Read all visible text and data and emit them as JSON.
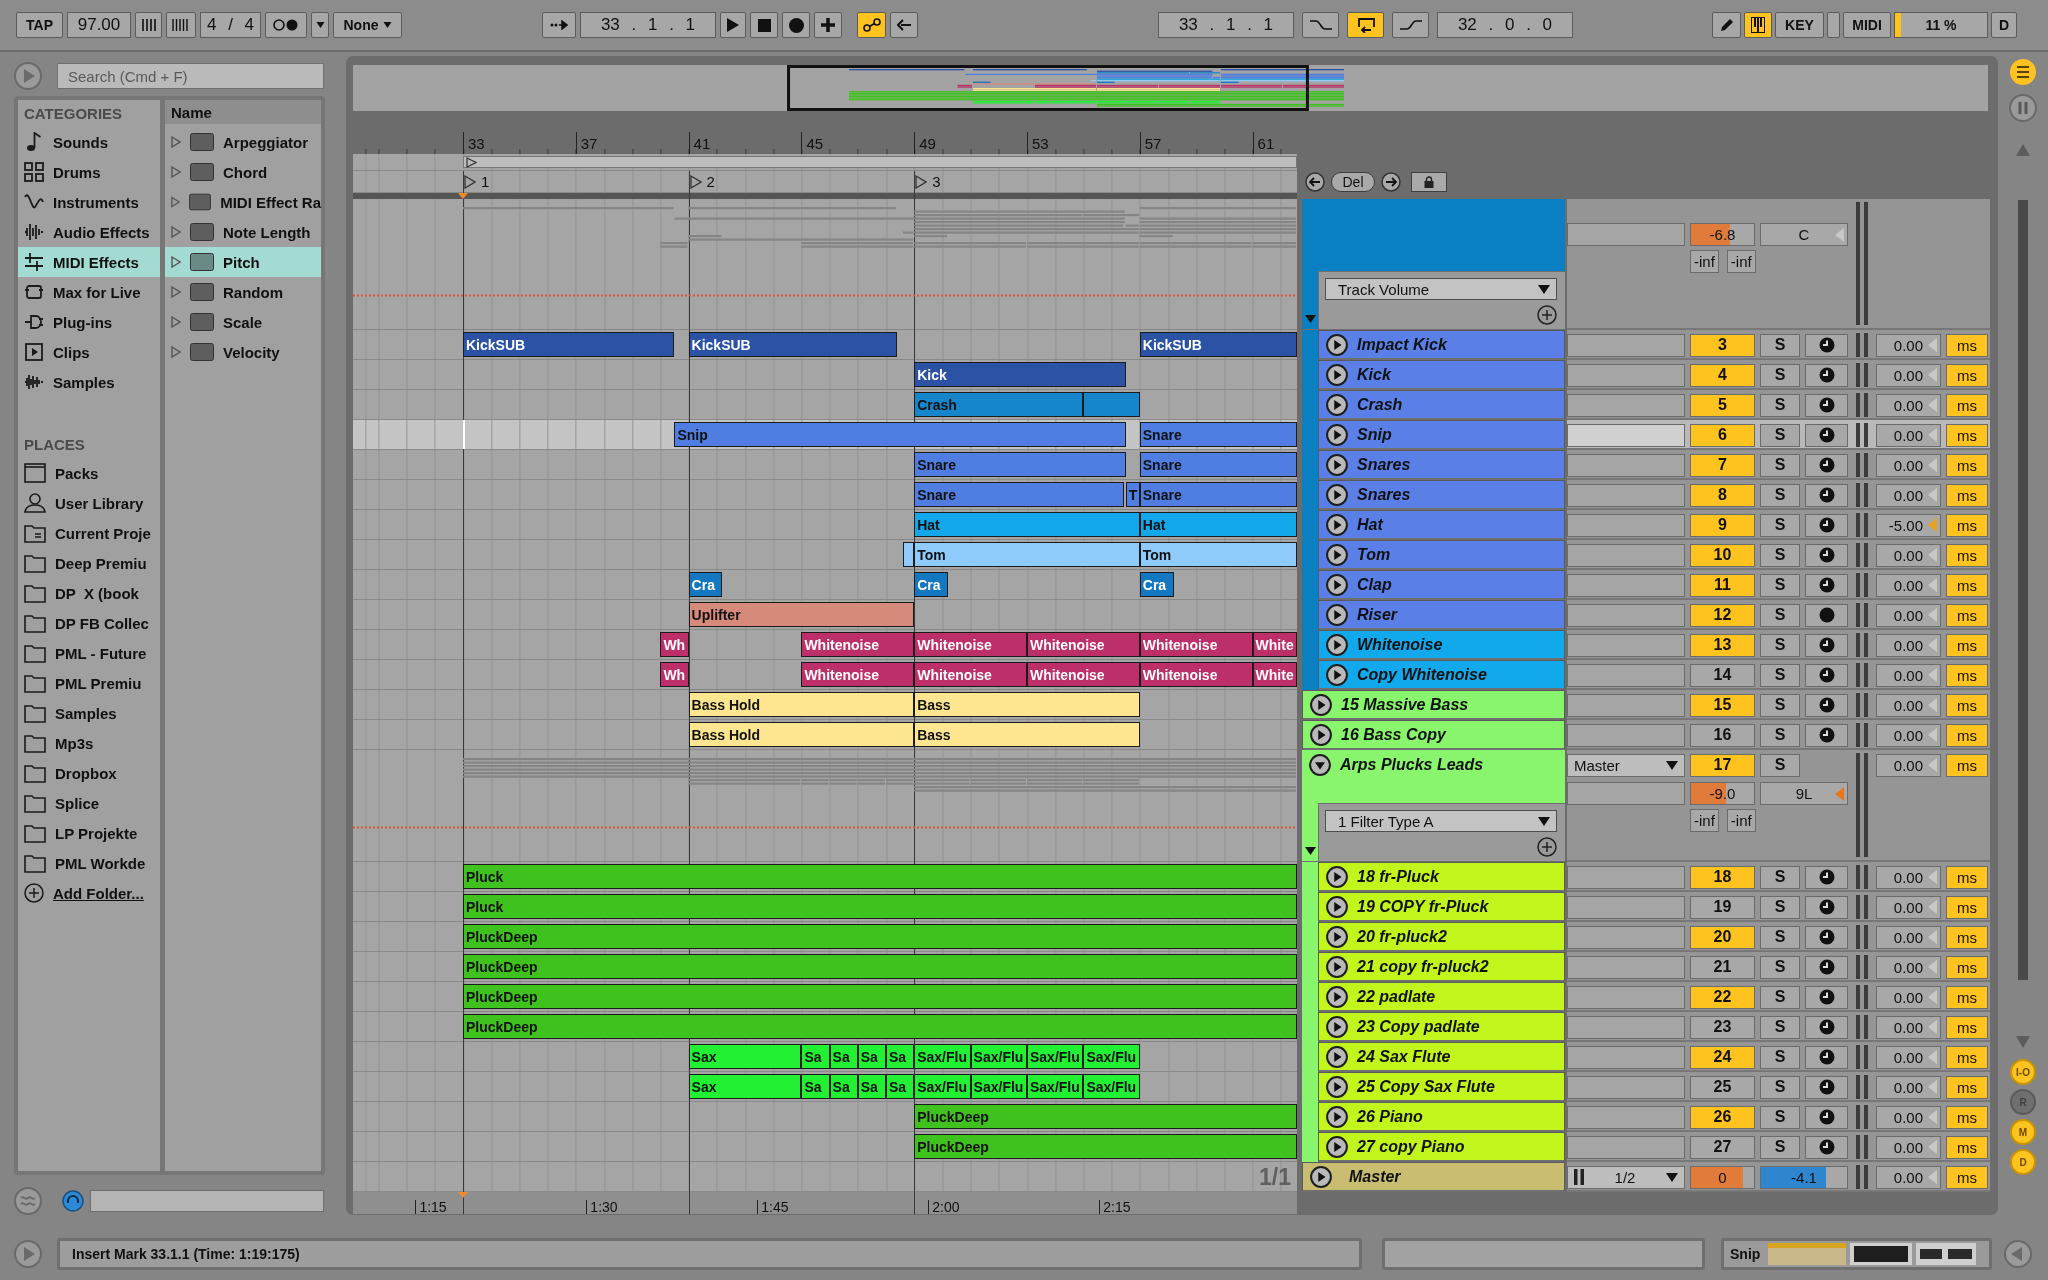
{
  "control_bar": {
    "tap": "TAP",
    "tempo": "97.00",
    "signature": "4 / 4",
    "quantize": "None",
    "position": "33 . 1 . 1",
    "automation_arm": {
      "on": true
    },
    "loop_start": "33 . 1 . 1",
    "loop": {
      "on": true
    },
    "loop_length": "32 . 0 . 0",
    "draw_mode": {
      "on": false
    },
    "keyboard": {
      "on": true
    },
    "key_map": "KEY",
    "midi_map": "MIDI",
    "cpu": {
      "reading": "11 %",
      "level": 0.06
    },
    "disk": "D"
  },
  "browser": {
    "search": {
      "placeholder": "Search (Cmd + F)"
    },
    "categories_title": "CATEGORIES",
    "categories": [
      {
        "label": "Sounds",
        "kind": "note",
        "selected": false
      },
      {
        "label": "Drums",
        "kind": "grid",
        "selected": false
      },
      {
        "label": "Instruments",
        "kind": "wave",
        "selected": false
      },
      {
        "label": "Audio Effects",
        "kind": "audio",
        "selected": false
      },
      {
        "label": "MIDI Effects",
        "kind": "midi",
        "selected": true
      },
      {
        "label": "Max for Live",
        "kind": "max",
        "selected": false
      },
      {
        "label": "Plug-ins",
        "kind": "plug",
        "selected": false
      },
      {
        "label": "Clips",
        "kind": "clip",
        "selected": false
      },
      {
        "label": "Samples",
        "kind": "sample",
        "selected": false
      }
    ],
    "places_title": "PLACES",
    "places": [
      {
        "label": "Packs",
        "kind": "pack"
      },
      {
        "label": "User Library",
        "kind": "user"
      },
      {
        "label": "Current Proje",
        "kind": "project"
      },
      {
        "label": "Deep Premiu",
        "kind": "folder"
      },
      {
        "label": "DP  X (book",
        "kind": "folder"
      },
      {
        "label": "DP FB Collec",
        "kind": "folder"
      },
      {
        "label": "PML - Future",
        "kind": "folder"
      },
      {
        "label": "PML Premiu",
        "kind": "folder"
      },
      {
        "label": "Samples",
        "kind": "folder"
      },
      {
        "label": "Mp3s",
        "kind": "folder"
      },
      {
        "label": "Dropbox",
        "kind": "folder"
      },
      {
        "label": "Splice",
        "kind": "folder"
      },
      {
        "label": "LP Projekte",
        "kind": "folder"
      },
      {
        "label": "PML Workde",
        "kind": "folder"
      }
    ],
    "add_folder": "Add Folder...",
    "column": "Name",
    "items": [
      {
        "label": "Arpeggiator",
        "selected": false
      },
      {
        "label": "Chord",
        "selected": false
      },
      {
        "label": "MIDI Effect Ra",
        "selected": false
      },
      {
        "label": "Note Length",
        "selected": false
      },
      {
        "label": "Pitch",
        "selected": true
      },
      {
        "label": "Random",
        "selected": false
      },
      {
        "label": "Scale",
        "selected": false
      },
      {
        "label": "Velocity",
        "selected": false
      }
    ]
  },
  "arrangement": {
    "ruler": [
      "33",
      "37",
      "41",
      "45",
      "49",
      "53",
      "57",
      "61"
    ],
    "locators": [
      "1",
      "2",
      "3"
    ],
    "delete": "Del",
    "tracks": [
      {
        "kind": "group",
        "color": "#0a80c2",
        "expanded": true,
        "selected": false,
        "automation": "Track Volume",
        "volume": {
          "reading": "-6.8",
          "level": 0.62
        },
        "pan": {
          "reading": "C",
          "modified": false
        },
        "peaks": [
          "-inf",
          "-inf"
        ],
        "children": [
          {
            "kind": "track",
            "name": "Impact Kick",
            "color": "#5a80e8",
            "number": "3",
            "active": true,
            "solo": "S",
            "armed": false,
            "delay": "0.00",
            "delay_modified": false,
            "unit": "ms",
            "selected": false,
            "clips": [
              {
                "name": "KickSUB",
                "color": "#2c52a5"
              },
              {
                "name": "KickSUB",
                "color": "#2c52a5"
              },
              {
                "name": "KickSUB",
                "color": "#2c52a5"
              }
            ]
          },
          {
            "kind": "track",
            "name": "Kick",
            "color": "#5a80e8",
            "number": "4",
            "active": true,
            "solo": "S",
            "armed": false,
            "delay": "0.00",
            "delay_modified": false,
            "unit": "ms",
            "selected": false,
            "clips": [
              {
                "name": "Kick",
                "color": "#2c52a5"
              }
            ]
          },
          {
            "kind": "track",
            "name": "Crash",
            "color": "#5a80e8",
            "number": "5",
            "active": true,
            "solo": "S",
            "armed": false,
            "delay": "0.00",
            "delay_modified": false,
            "unit": "ms",
            "selected": false,
            "clips": [
              {
                "name": "Crash",
                "color": "#1585cc"
              },
              {
                "color": "#1585cc"
              }
            ]
          },
          {
            "kind": "track",
            "name": "Snip",
            "color": "#5a80e8",
            "number": "6",
            "active": true,
            "solo": "S",
            "armed": false,
            "delay": "0.00",
            "delay_modified": false,
            "unit": "ms",
            "selected": true,
            "clips": [
              {
                "name": "Snip",
                "color": "#4f7de2"
              },
              {
                "name": "Snare",
                "color": "#4f7de2"
              }
            ]
          },
          {
            "kind": "track",
            "name": "Snares",
            "color": "#5a80e8",
            "number": "7",
            "active": true,
            "solo": "S",
            "armed": false,
            "delay": "0.00",
            "delay_modified": false,
            "unit": "ms",
            "selected": false,
            "clips": [
              {
                "name": "Snare",
                "color": "#4f7de2"
              },
              {
                "name": "Snare",
                "color": "#4f7de2"
              }
            ]
          },
          {
            "kind": "track",
            "name": "Snares",
            "color": "#5a80e8",
            "number": "8",
            "active": true,
            "solo": "S",
            "armed": false,
            "delay": "0.00",
            "delay_modified": false,
            "unit": "ms",
            "selected": false,
            "clips": [
              {
                "name": "Snare",
                "color": "#4f7de2"
              },
              {
                "name": "T",
                "color": "#4f7de2"
              },
              {
                "name": "Snare",
                "color": "#4f7de2"
              }
            ]
          },
          {
            "kind": "track",
            "name": "Hat",
            "color": "#5a80e8",
            "number": "9",
            "active": true,
            "solo": "S",
            "armed": false,
            "delay": "-5.00",
            "delay_modified": true,
            "unit": "ms",
            "selected": false,
            "clips": [
              {
                "name": "Hat",
                "color": "#12a6ea"
              },
              {
                "name": "Hat",
                "color": "#12a6ea"
              }
            ]
          },
          {
            "kind": "track",
            "name": "Tom",
            "color": "#5a80e8",
            "number": "10",
            "active": true,
            "solo": "S",
            "armed": false,
            "delay": "0.00",
            "delay_modified": false,
            "unit": "ms",
            "selected": false,
            "clips": [
              {
                "color": "#8ecbfa"
              },
              {
                "name": "Tom",
                "color": "#8ecbfa"
              },
              {
                "name": "Tom",
                "color": "#8ecbfa"
              }
            ]
          },
          {
            "kind": "track",
            "name": "Clap",
            "color": "#5a80e8",
            "number": "11",
            "active": true,
            "solo": "S",
            "armed": false,
            "delay": "0.00",
            "delay_modified": false,
            "unit": "ms",
            "selected": false,
            "clips": [
              {
                "name": "Cra",
                "color": "#1477c2"
              },
              {
                "name": "Cra",
                "color": "#1477c2"
              },
              {
                "name": "Cra",
                "color": "#1477c2"
              }
            ]
          },
          {
            "kind": "track",
            "name": "Riser",
            "color": "#5a80e8",
            "number": "12",
            "active": true,
            "solo": "S",
            "armed": true,
            "delay": "0.00",
            "delay_modified": false,
            "unit": "ms",
            "selected": false,
            "clips": [
              {
                "name": "Uplifter",
                "color": "#d68a7b"
              }
            ]
          },
          {
            "kind": "track",
            "name": "Whitenoise",
            "color": "#12a8ec",
            "number": "13",
            "active": true,
            "solo": "S",
            "armed": false,
            "delay": "0.00",
            "delay_modified": false,
            "unit": "ms",
            "selected": false,
            "clips": [
              {
                "name": "Wh",
                "color": "#bd2f68"
              },
              {
                "name": "Whitenoise",
                "color": "#bd2f68"
              },
              {
                "name": "Whitenoise",
                "color": "#bd2f68"
              },
              {
                "name": "Whitenoise",
                "color": "#bd2f68"
              },
              {
                "name": "Whitenoise",
                "color": "#bd2f68"
              },
              {
                "name": "White",
                "color": "#bd2f68"
              }
            ]
          },
          {
            "kind": "track",
            "name": "Copy Whitenoise",
            "color": "#12a8ec",
            "number": "14",
            "active": false,
            "solo": "S",
            "armed": false,
            "delay": "0.00",
            "delay_modified": false,
            "unit": "ms",
            "selected": false,
            "clips": [
              {
                "name": "Wh",
                "color": "#bd2f68"
              },
              {
                "name": "Whitenoise",
                "color": "#bd2f68"
              },
              {
                "name": "Whitenoise",
                "color": "#bd2f68"
              },
              {
                "name": "Whitenoise",
                "color": "#bd2f68"
              },
              {
                "name": "Whitenoise",
                "color": "#bd2f68"
              },
              {
                "name": "White",
                "color": "#bd2f68"
              }
            ]
          }
        ]
      },
      {
        "kind": "track",
        "name": "15 Massive Bass",
        "color": "#88f56c",
        "number": "15",
        "active": true,
        "solo": "S",
        "armed": false,
        "delay": "0.00",
        "delay_modified": false,
        "unit": "ms",
        "selected": false,
        "clips": [
          {
            "name": "Bass Hold",
            "color": "#fde68f"
          },
          {
            "name": "Bass",
            "color": "#fde68f"
          }
        ]
      },
      {
        "kind": "track",
        "name": "16 Bass Copy",
        "color": "#88f56c",
        "number": "16",
        "active": false,
        "solo": "S",
        "armed": false,
        "delay": "0.00",
        "delay_modified": false,
        "unit": "ms",
        "selected": false,
        "clips": [
          {
            "name": "Bass Hold",
            "color": "#fde68f"
          },
          {
            "name": "Bass",
            "color": "#fde68f"
          }
        ]
      },
      {
        "kind": "group",
        "name": "Arps Plucks Leads",
        "color": "#88f56c",
        "expanded": true,
        "selected": false,
        "route": "Master",
        "number": "17",
        "active": true,
        "solo": "S",
        "delay": "0.00",
        "unit": "ms",
        "automation": "1 Filter Type A",
        "volume": {
          "reading": "-9.0",
          "level": 0.55
        },
        "pan": {
          "reading": "9L",
          "modified": true
        },
        "peaks": [
          "-inf",
          "-inf"
        ],
        "children": [
          {
            "kind": "track",
            "name": "18 fr-Pluck",
            "color": "#c2f51c",
            "number": "18",
            "active": true,
            "solo": "S",
            "armed": false,
            "delay": "0.00",
            "delay_modified": false,
            "unit": "ms",
            "selected": false,
            "clips": [
              {
                "name": "Pluck",
                "color": "#3fc21d"
              }
            ]
          },
          {
            "kind": "track",
            "name": "19 COPY fr-Pluck",
            "color": "#c2f51c",
            "number": "19",
            "active": false,
            "solo": "S",
            "armed": false,
            "delay": "0.00",
            "delay_modified": false,
            "unit": "ms",
            "selected": false,
            "clips": [
              {
                "name": "Pluck",
                "color": "#3fc21d"
              }
            ]
          },
          {
            "kind": "track",
            "name": "20 fr-pluck2",
            "color": "#c2f51c",
            "number": "20",
            "active": true,
            "solo": "S",
            "armed": false,
            "delay": "0.00",
            "delay_modified": false,
            "unit": "ms",
            "selected": false,
            "clips": [
              {
                "name": "PluckDeep",
                "color": "#3fc21d"
              }
            ]
          },
          {
            "kind": "track",
            "name": "21 copy fr-pluck2",
            "color": "#c2f51c",
            "number": "21",
            "active": false,
            "solo": "S",
            "armed": false,
            "delay": "0.00",
            "delay_modified": false,
            "unit": "ms",
            "selected": false,
            "clips": [
              {
                "name": "PluckDeep",
                "color": "#3fc21d"
              }
            ]
          },
          {
            "kind": "track",
            "name": "22 padlate",
            "color": "#c2f51c",
            "number": "22",
            "active": true,
            "solo": "S",
            "armed": false,
            "delay": "0.00",
            "delay_modified": false,
            "unit": "ms",
            "selected": false,
            "clips": [
              {
                "name": "PluckDeep",
                "color": "#3fc21d"
              }
            ]
          },
          {
            "kind": "track",
            "name": "23 Copy padlate",
            "color": "#c2f51c",
            "number": "23",
            "active": false,
            "solo": "S",
            "armed": false,
            "delay": "0.00",
            "delay_modified": false,
            "unit": "ms",
            "selected": false,
            "clips": [
              {
                "name": "PluckDeep",
                "color": "#3fc21d"
              }
            ]
          },
          {
            "kind": "track",
            "name": "24 Sax Flute",
            "color": "#c2f51c",
            "number": "24",
            "active": true,
            "solo": "S",
            "armed": false,
            "delay": "0.00",
            "delay_modified": false,
            "unit": "ms",
            "selected": false,
            "clips": [
              {
                "name": "Sax",
                "color": "#22f032"
              },
              {
                "name": "Sa",
                "color": "#22f032"
              },
              {
                "name": "Sa",
                "color": "#22f032"
              },
              {
                "name": "Sa",
                "color": "#22f032"
              },
              {
                "name": "Sa",
                "color": "#22f032"
              },
              {
                "name": "Sax/Flu",
                "color": "#22f032"
              },
              {
                "name": "Sax/Flu",
                "color": "#22f032"
              },
              {
                "name": "Sax/Flu",
                "color": "#22f032"
              },
              {
                "name": "Sax/Flu",
                "color": "#22f032"
              }
            ]
          },
          {
            "kind": "track",
            "name": "25 Copy Sax Flute",
            "color": "#c2f51c",
            "number": "25",
            "active": false,
            "solo": "S",
            "armed": false,
            "delay": "0.00",
            "delay_modified": false,
            "unit": "ms",
            "selected": false,
            "clips": [
              {
                "name": "Sax",
                "color": "#22f032"
              },
              {
                "name": "Sa",
                "color": "#22f032"
              },
              {
                "name": "Sa",
                "color": "#22f032"
              },
              {
                "name": "Sa",
                "color": "#22f032"
              },
              {
                "name": "Sa",
                "color": "#22f032"
              },
              {
                "name": "Sax/Flu",
                "color": "#22f032"
              },
              {
                "name": "Sax/Flu",
                "color": "#22f032"
              },
              {
                "name": "Sax/Flu",
                "color": "#22f032"
              },
              {
                "name": "Sax/Flu",
                "color": "#22f032"
              }
            ]
          },
          {
            "kind": "track",
            "name": "26 Piano",
            "color": "#c2f51c",
            "number": "26",
            "active": true,
            "solo": "S",
            "armed": false,
            "delay": "0.00",
            "delay_modified": false,
            "unit": "ms",
            "selected": false,
            "clips": [
              {
                "name": "PluckDeep",
                "color": "#3fc21d"
              }
            ]
          },
          {
            "kind": "track",
            "name": "27 copy Piano",
            "color": "#c2f51c",
            "number": "27",
            "active": false,
            "solo": "S",
            "armed": false,
            "delay": "0.00",
            "delay_modified": false,
            "unit": "ms",
            "selected": false,
            "clips": [
              {
                "name": "PluckDeep",
                "color": "#3fc21d"
              }
            ]
          }
        ]
      }
    ],
    "master": {
      "name": "Master",
      "color": "#c9bd72",
      "route": "1/2",
      "volume": {
        "reading": "0",
        "level": 0.82
      },
      "cue": {
        "reading": "-4.1",
        "level": 0.75
      },
      "delay": "0.00",
      "unit": "ms"
    },
    "page": "1/1",
    "time_ruler": [
      "1:15",
      "1:30",
      "1:45",
      "2:00",
      "2:15"
    ]
  },
  "view_buttons": [
    {
      "label": "I-O",
      "on": true
    },
    {
      "label": "R",
      "on": false
    },
    {
      "label": "M",
      "on": true
    },
    {
      "label": "D",
      "on": true
    }
  ],
  "status_bar": {
    "message": "Insert Mark 33.1.1 (Time: 1:19:175)",
    "clip": "Snip"
  }
}
